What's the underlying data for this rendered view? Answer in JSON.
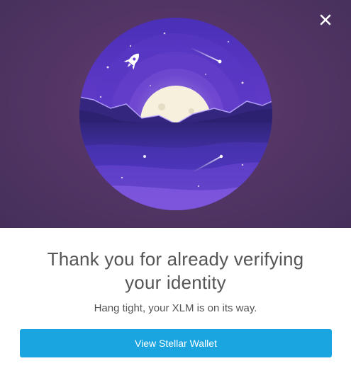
{
  "dialog": {
    "close_icon": "close-icon",
    "headline": "Thank you for already verifying your identity",
    "subtext": "Hang tight, your XLM is on its way.",
    "button_label": "View Stellar Wallet"
  },
  "illustration": {
    "icons": [
      "rocket-icon",
      "moon-icon",
      "shooting-star-icon"
    ],
    "colors": {
      "background": "#553566",
      "sky": "#6d3fd0",
      "water": "#3a2a9a",
      "moon": "#f6f0dc"
    }
  },
  "theme": {
    "accent": "#1aa5e1",
    "text": "#555555"
  }
}
